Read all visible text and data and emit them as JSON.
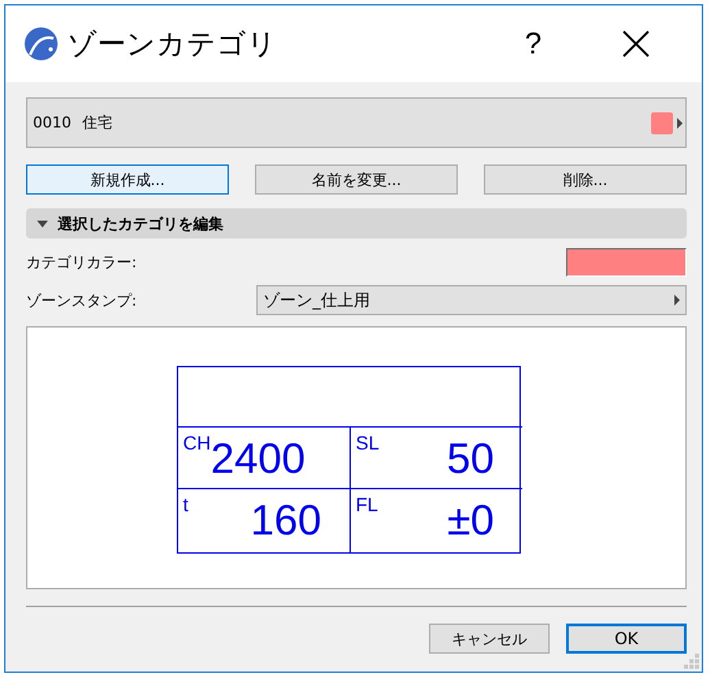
{
  "window": {
    "title": "ゾーンカテゴリ",
    "help": "?"
  },
  "category": {
    "code": "0010",
    "name": "住宅",
    "color": "#ff8080"
  },
  "buttons": [
    {
      "label": "新規作成...",
      "focused": true
    },
    {
      "label": "名前を変更...",
      "focused": false
    },
    {
      "label": "削除...",
      "focused": false
    }
  ],
  "section": {
    "label": "選択したカテゴリを編集",
    "expanded": true
  },
  "category_color": {
    "label": "カテゴリカラー:",
    "color": "#ff8080"
  },
  "zone_stamp": {
    "label": "ゾーンスタンプ:",
    "value": "ゾーン_仕上用"
  },
  "preview": {
    "cells": [
      {
        "label": "CH",
        "value": "2400"
      },
      {
        "label": "SL",
        "value": "50"
      },
      {
        "label": "t",
        "value": "160"
      },
      {
        "label": "FL",
        "value": "±0"
      }
    ]
  },
  "footer_buttons": [
    {
      "label": "キャンセル",
      "focused": false
    },
    {
      "label": "OK",
      "focused": true
    }
  ]
}
